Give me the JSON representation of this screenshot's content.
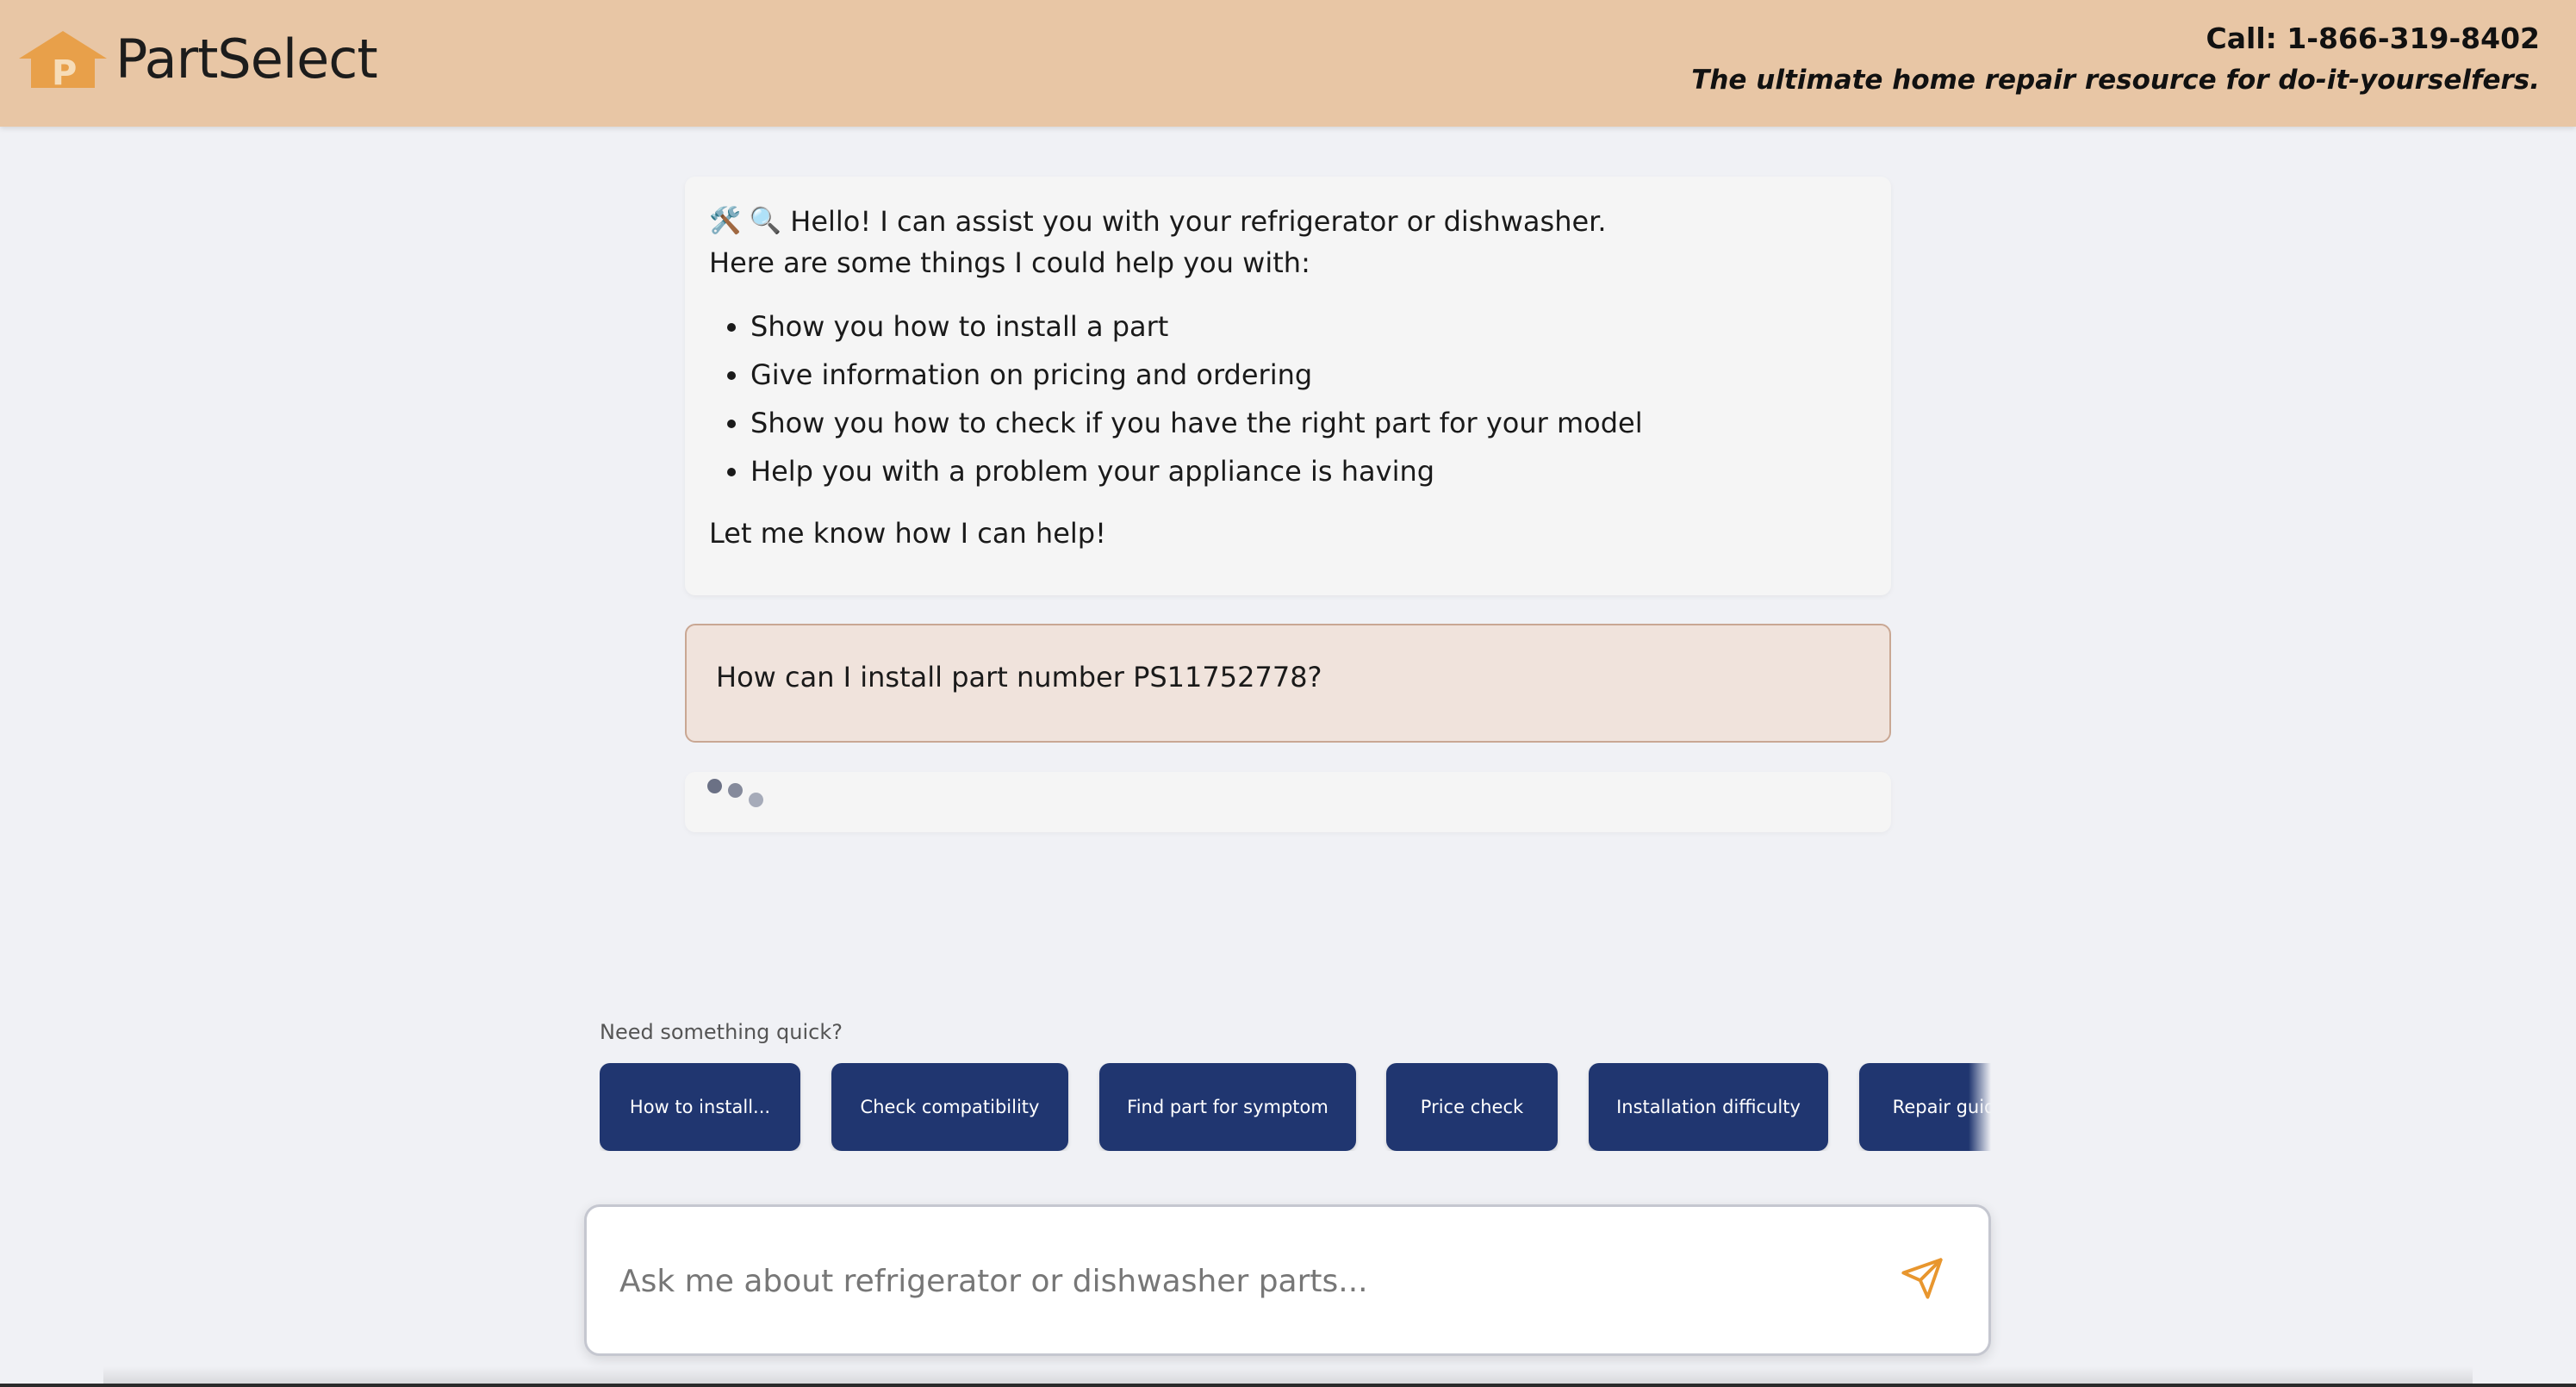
{
  "header": {
    "logo_text": "PartSelect",
    "phone": "Call: 1-866-319-8402",
    "tagline": "The ultimate home repair resource for do-it-yourselfers."
  },
  "chat": {
    "bot_greeting": "Hello! I can assist you with your refrigerator or dishwasher.",
    "bot_emoji": "🛠️ 🔍",
    "bot_intro": "Here are some things I could help you with:",
    "bot_options": [
      "Show you how to install a part",
      "Give information on pricing and ordering",
      "Show you how to check if you have the right part for your model",
      "Help you with a problem your appliance is having"
    ],
    "bot_closing": "Let me know how I can help!",
    "user_message": "How can I install part number PS11752778?"
  },
  "quick": {
    "label": "Need something quick?",
    "buttons": [
      "How to install...",
      "Check compatibility",
      "Find part for symptom",
      "Price check",
      "Installation difficulty",
      "Repair guide"
    ]
  },
  "input": {
    "placeholder": "Ask me about refrigerator or dishwasher parts...",
    "send_icon": "send-icon"
  },
  "colors": {
    "header_bg": "#e8c6a5",
    "logo_orange": "#e8a04a",
    "quick_button": "#203670",
    "user_bubble": "#f0e3dc",
    "send_icon": "#e8962e"
  }
}
